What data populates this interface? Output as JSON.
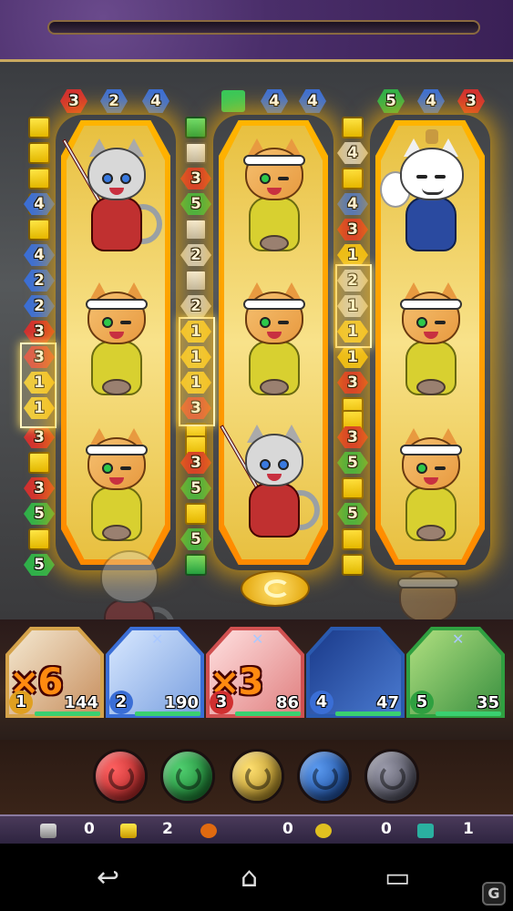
{
  "reel_headers": {
    "reel1": [
      "3",
      "2",
      "4"
    ],
    "reel2": [
      "",
      "4",
      "4"
    ],
    "reel3": [
      "5",
      "4",
      "3"
    ]
  },
  "strips": {
    "strip1": [
      "",
      "",
      "",
      "",
      "4",
      "",
      "4",
      "2",
      "2",
      "3",
      "3",
      "1",
      "1",
      "3",
      "",
      "3",
      "5",
      "",
      "5"
    ],
    "strip2": [
      "",
      "",
      "",
      "3",
      "5",
      "",
      "2",
      "",
      "2",
      "1",
      "1",
      "1",
      "3",
      "",
      "",
      "3",
      "5",
      "",
      "5",
      ""
    ],
    "strip3": [
      "",
      "4",
      "",
      "4",
      "3",
      "1",
      "2",
      "1",
      "1",
      "1",
      "3",
      "",
      "",
      "3",
      "5",
      "",
      "5",
      "",
      ""
    ]
  },
  "team": [
    {
      "slot": "1",
      "hp": "144",
      "multiplier": "×6"
    },
    {
      "slot": "2",
      "hp": "190",
      "multiplier": ""
    },
    {
      "slot": "3",
      "hp": "86",
      "multiplier": "×3"
    },
    {
      "slot": "4",
      "hp": "47",
      "multiplier": ""
    },
    {
      "slot": "5",
      "hp": "35",
      "multiplier": ""
    }
  ],
  "orbs": [
    {
      "name": "fire",
      "color": "#c02020"
    },
    {
      "name": "wood",
      "color": "#1a8a30"
    },
    {
      "name": "light",
      "color": "#c8a020"
    },
    {
      "name": "water",
      "color": "#1a5ab0"
    },
    {
      "name": "dark",
      "color": "#6a6a78"
    }
  ],
  "counters": {
    "silver": "0",
    "gold": "2",
    "cat": "0",
    "swirl": "0",
    "bonus": "1"
  },
  "colors": {
    "accent": "#ff9a00",
    "frame": "#c9a860"
  }
}
